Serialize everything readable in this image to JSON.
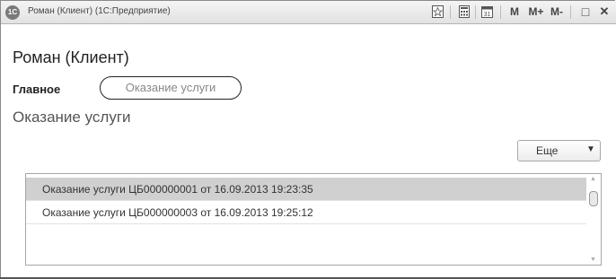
{
  "window": {
    "app_icon_text": "1С",
    "title": "Роман (Клиент)  (1С:Предприятие)",
    "toolbar": {
      "m_label": "M",
      "mplus_label": "M+",
      "mminus_label": "M-",
      "close_label": "✕",
      "maximize_label": "□"
    }
  },
  "form": {
    "title": "Роман (Клиент)",
    "nav": {
      "main_label": "Главное",
      "link_label": "Оказание услуги"
    },
    "section_title": "Оказание услуги",
    "more_button_label": "Еще",
    "more_button_arrow": "▼",
    "list": {
      "rows": [
        {
          "text": "Оказание услуги ЦБ000000001 от 16.09.2013 19:23:35",
          "selected": true
        },
        {
          "text": "Оказание услуги ЦБ000000003 от 16.09.2013 19:25:12",
          "selected": false
        }
      ]
    }
  }
}
